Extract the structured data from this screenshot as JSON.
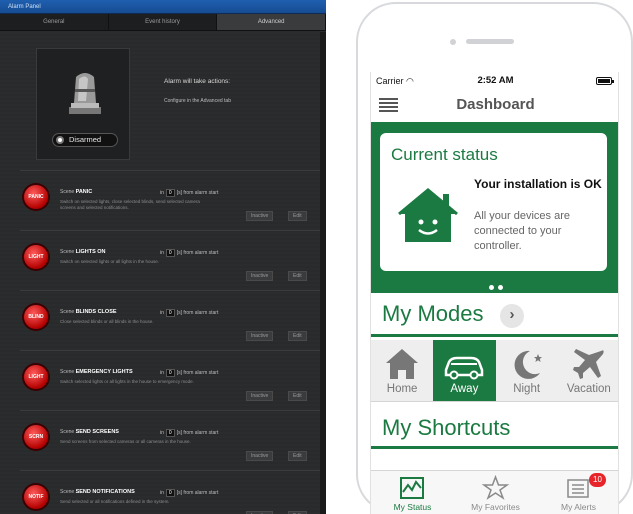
{
  "alarm_panel": {
    "window_title": "Alarm Panel",
    "tabs": [
      "General",
      "Event history",
      "Advanced"
    ],
    "active_tab": "Advanced",
    "state_button": "Disarmed",
    "actions_title": "Alarm will take actions:",
    "actions_subtitle": "Configure in the Advanced tab",
    "scene_prefix": "Scene",
    "in_label": "in",
    "from_label": "[s] from alarm start",
    "inactive_label": "Inactive",
    "edit_label": "Edit",
    "scenes": [
      {
        "icon": "PANIC",
        "name": "PANIC",
        "seconds": "0",
        "desc": "Switch on selected lights, close selected blinds, send selected camera screens and selected notifications."
      },
      {
        "icon": "LIGHT",
        "name": "LIGHTS ON",
        "seconds": "0",
        "desc": "Switch on selected lights or all lights in the house."
      },
      {
        "icon": "BLIND",
        "name": "BLINDS CLOSE",
        "seconds": "0",
        "desc": "Close selected blinds or all blinds in the house."
      },
      {
        "icon": "LIGHT",
        "name": "EMERGENCY LIGHTS",
        "seconds": "0",
        "desc": "Switch selected lights or all lights in the house to emergency mode."
      },
      {
        "icon": "SCRN",
        "name": "SEND SCREENS",
        "seconds": "0",
        "desc": "Send screens from selected cameras or all cameras in the house."
      },
      {
        "icon": "NOTIF",
        "name": "SEND NOTIFICATIONS",
        "seconds": "0",
        "desc": "Send selected or all notifications defined in the system."
      }
    ]
  },
  "phone": {
    "carrier": "Carrier",
    "time": "2:52 AM",
    "title": "Dashboard",
    "status_title": "Current status",
    "status_heading": "Your installation is OK",
    "status_body": "All your devices are connected to your controller.",
    "modes_title": "My Modes",
    "modes": [
      {
        "label": "Home",
        "icon": "house-icon",
        "active": false
      },
      {
        "label": "Away",
        "icon": "car-icon",
        "active": true
      },
      {
        "label": "Night",
        "icon": "moon-icon",
        "active": false
      },
      {
        "label": "Vacation",
        "icon": "airplane-icon",
        "active": false
      }
    ],
    "shortcuts_title": "My Shortcuts",
    "tabs": [
      {
        "label": "My Status",
        "icon": "chart-icon"
      },
      {
        "label": "My Favorites",
        "icon": "star-icon"
      },
      {
        "label": "My Alerts",
        "icon": "alerts-icon",
        "badge": "10"
      }
    ],
    "brand_green": "#1b7a41"
  }
}
